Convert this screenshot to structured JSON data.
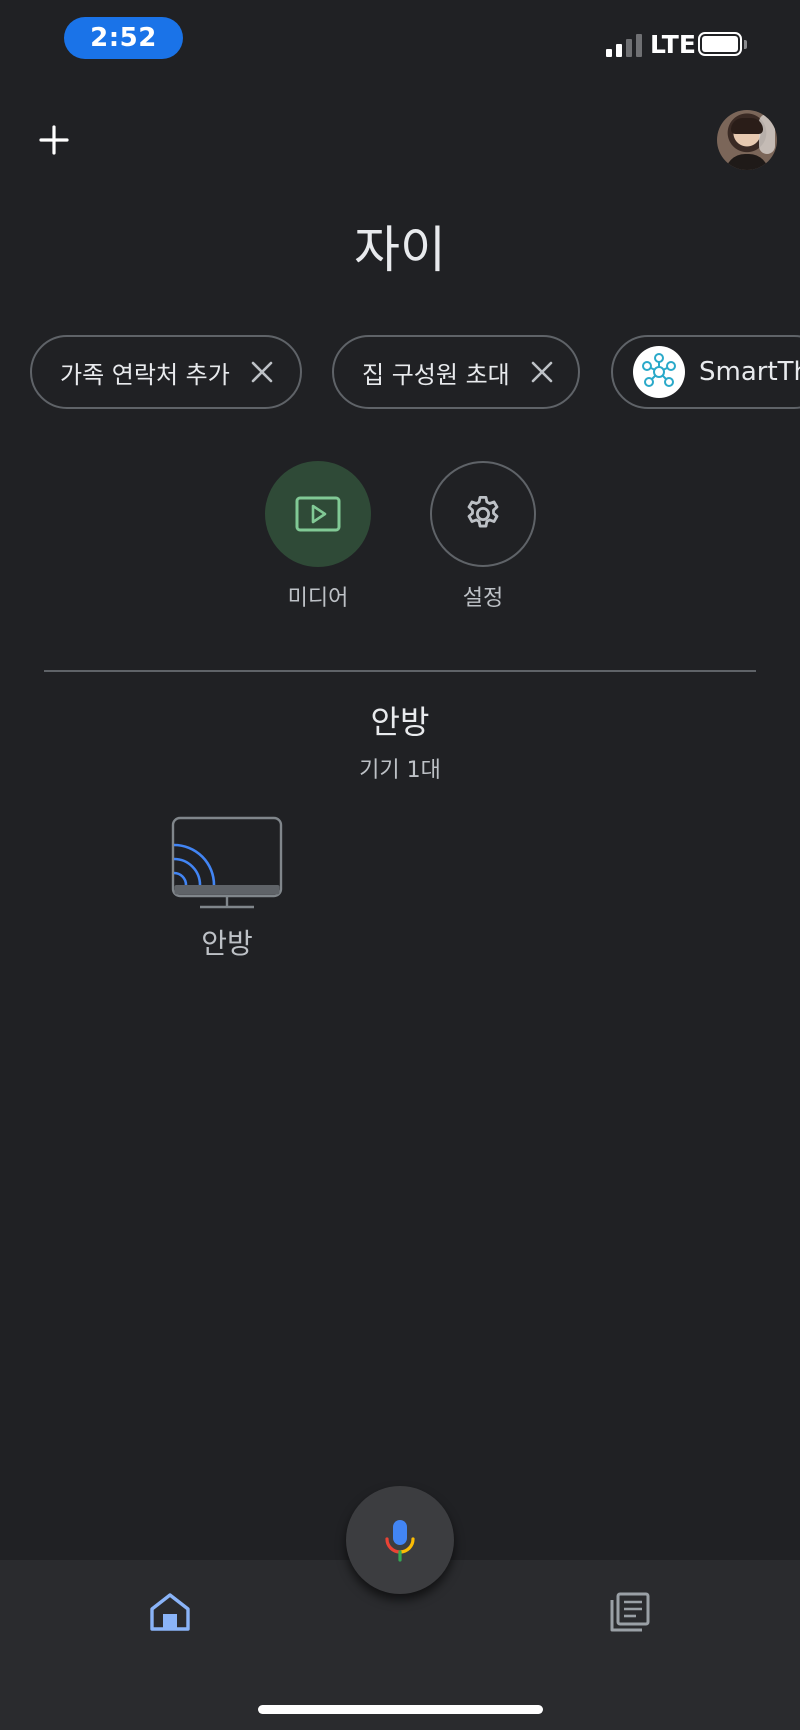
{
  "status_bar": {
    "time": "2:52",
    "network": "LTE"
  },
  "header": {
    "home_name": "자이"
  },
  "chips": [
    {
      "label": "가족 연락처 추가",
      "icon": "close-icon"
    },
    {
      "label": "집 구성원 초대",
      "icon": "close-icon"
    },
    {
      "label": "SmartTh",
      "icon": "smartthings-icon"
    }
  ],
  "actions": {
    "media_label": "미디어",
    "settings_label": "설정"
  },
  "room": {
    "name": "안방",
    "device_count": "기기 1대",
    "devices": [
      {
        "label": "안방",
        "icon": "cast-tv-icon"
      }
    ]
  },
  "colors": {
    "background": "#202124",
    "time_pill": "#1a73e8",
    "media_button": "#2f4a37",
    "media_accent": "#81c995",
    "active_nav": "#8ab4f8"
  }
}
